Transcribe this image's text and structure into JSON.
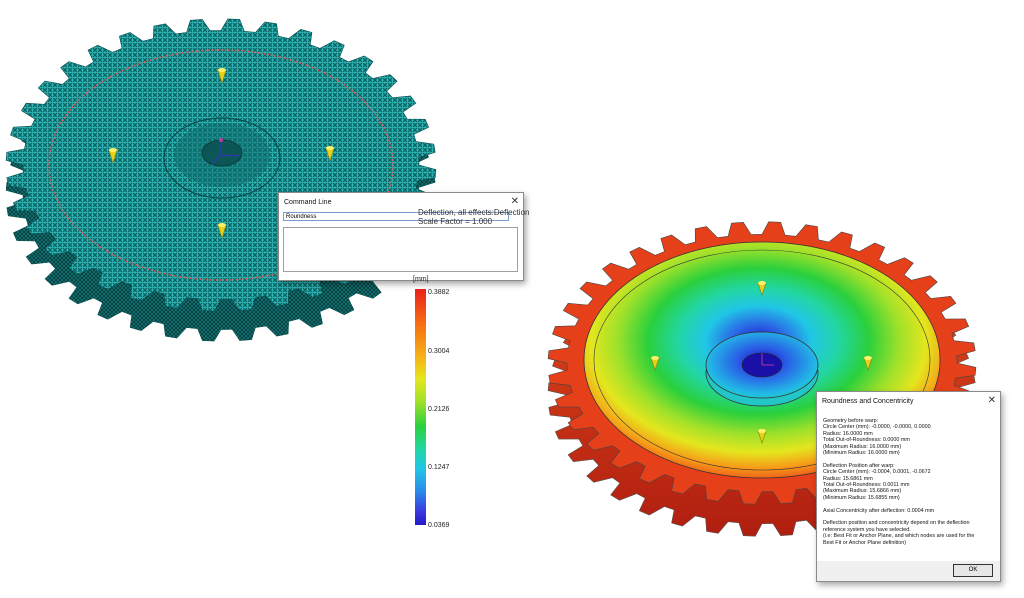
{
  "command_dialog": {
    "title": "Command Line",
    "close_glyph": "✕",
    "input_value": "Roundness"
  },
  "deflection_info": {
    "line1": "Deflection, all effects:Deflection",
    "line2": "Scale Factor = 1.000"
  },
  "colorbar": {
    "unit": "[mm]",
    "ticks": [
      "0.3882",
      "0.3004",
      "0.2126",
      "0.1247",
      "0.0369"
    ]
  },
  "roundness_dialog": {
    "title": "Roundness and Concentricity",
    "close_glyph": "✕",
    "lines": [
      "Geometry before warp:",
      "Circle Center (mm): -0.0000, -0.0000, 0.0000",
      "Radius: 16.0000 mm",
      "Total Out-of-Roundness: 0.0000 mm",
      "(Maximum Radius: 16.0000 mm)",
      "(Minimum Radius: 16.0000 mm)",
      "",
      "Deflection Position after warp:",
      "Circle Center (mm): -0.0004, 0.0001, -0.0672",
      "Radius: 15.6861 mm",
      "Total Out-of-Roundness: 0.0011 mm",
      "(Maximum Radius: 15.6866 mm)",
      "(Minimum Radius: 15.6855 mm)",
      "",
      "Axial Concentricity after deflection: 0.0004 mm",
      "",
      "Deflection position and concentricity depend on the deflection",
      "reference system you have selected.",
      "(i.e: Best Fit or Anchor Plane, and which nodes are used for the",
      "Best Fit or Anchor Plane definition)"
    ],
    "ok_label": "OK"
  },
  "colors": {
    "mesh_teal": "#1fb5b5",
    "mesh_dark": "#0b4d4d",
    "red_ring": "#e85a5a",
    "hot": "#e8201a",
    "cool": "#2418c8"
  },
  "icons": {
    "pin": "yellow-pin-icon",
    "axis": "axis-triad-icon"
  }
}
